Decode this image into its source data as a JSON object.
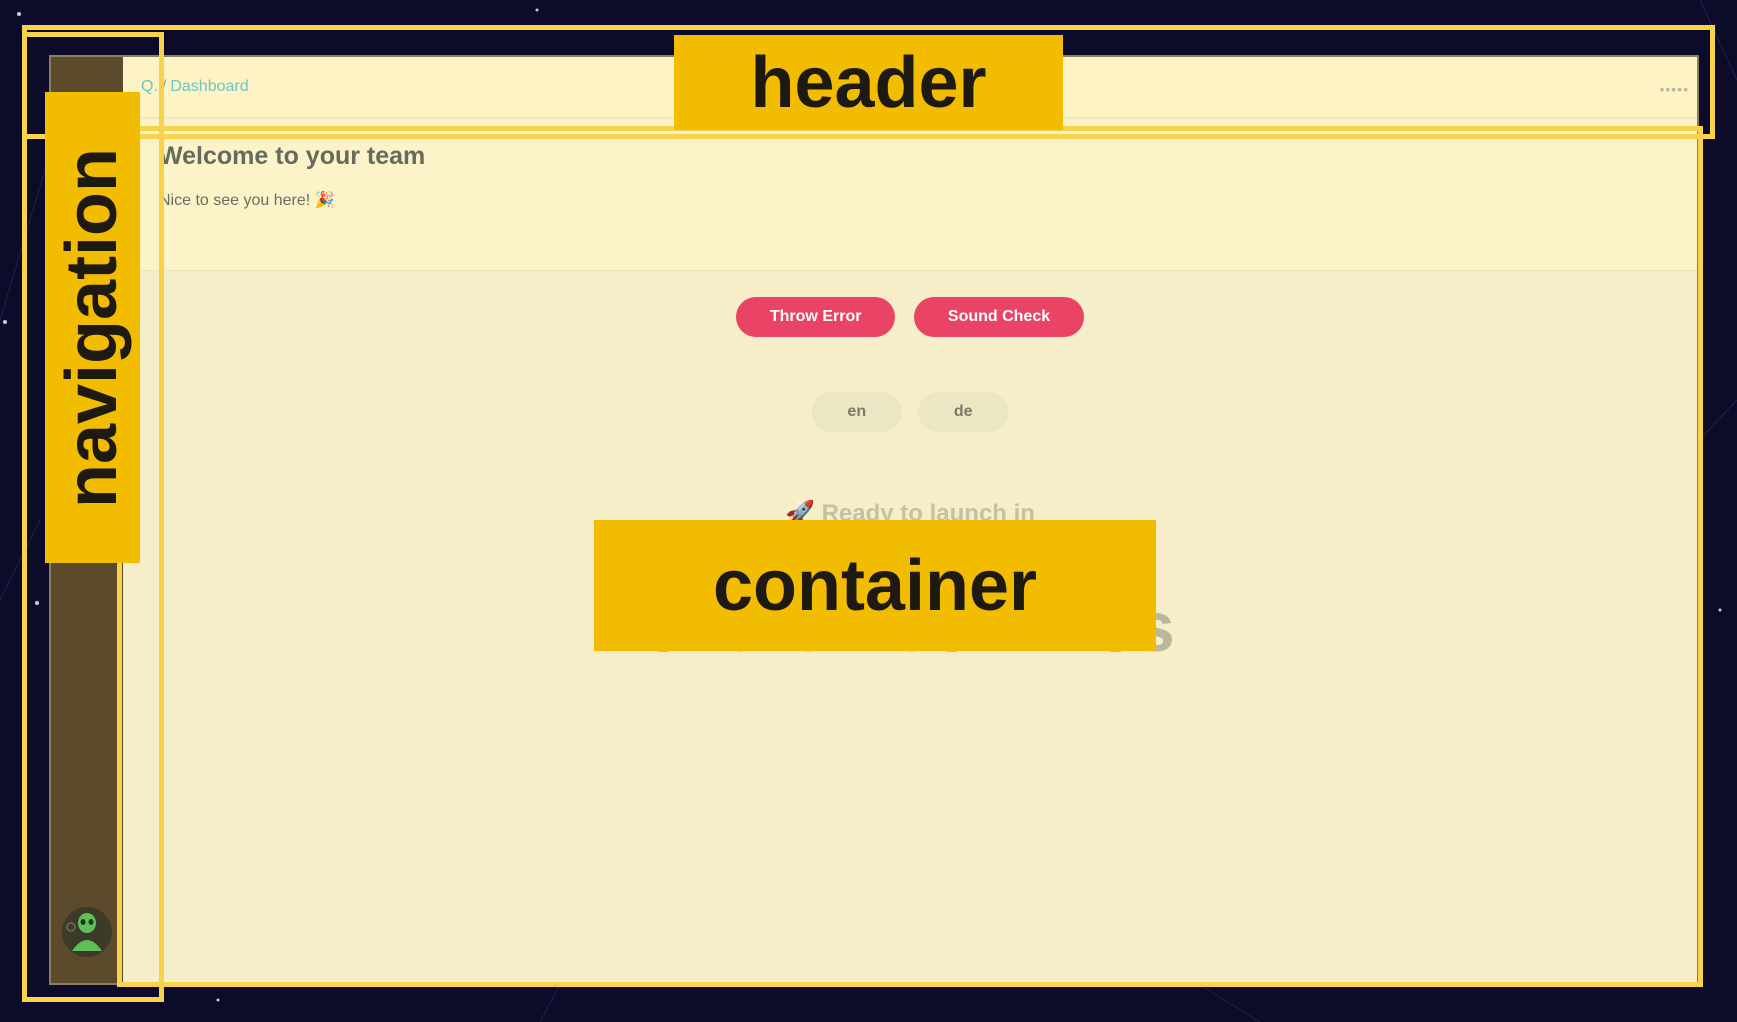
{
  "breadcrumb": {
    "root": "Q.",
    "separator": "/",
    "current": "Dashboard"
  },
  "menu_dots": "•••••",
  "welcome": {
    "title": "Welcome to your team",
    "subtitle": "Nice to see you here! 🎉"
  },
  "buttons": {
    "throw_error": "Throw Error",
    "sound_check": "Sound Check"
  },
  "languages": [
    "en",
    "de"
  ],
  "launch": {
    "title": "🚀 Ready to launch in",
    "countdown": "32d 6h 53m 43s"
  },
  "annotations": {
    "header": "header",
    "navigation": "navigation",
    "container": "container"
  },
  "colors": {
    "accent": "#e94366",
    "annotation": "#f2bc00",
    "link": "#6fc4c4"
  }
}
